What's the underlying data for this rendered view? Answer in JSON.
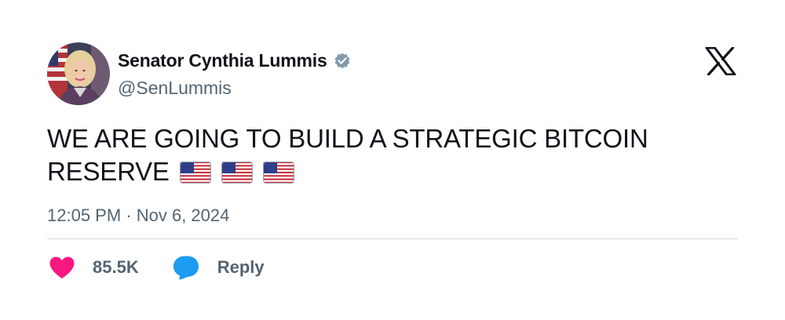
{
  "author": {
    "display_name": "Senator Cynthia Lummis",
    "handle": "@SenLummis",
    "verified": true,
    "verified_badge_color": "#829aab",
    "avatar": "avatar-photo"
  },
  "platform": {
    "logo": "x-logo-icon"
  },
  "tweet": {
    "text": "WE ARE GOING TO BUILD A STRATEGIC BITCOIN RESERVE",
    "emojis": [
      "us-flag-icon",
      "us-flag-icon",
      "us-flag-icon"
    ],
    "timestamp": "12:05 PM · Nov 6, 2024"
  },
  "actions": {
    "like": {
      "icon": "heart-icon",
      "count": "85.5K",
      "color": "#f91880"
    },
    "reply": {
      "icon": "speech-bubble-icon",
      "label": "Reply",
      "color": "#1d9bf0"
    }
  },
  "colors": {
    "text_primary": "#0f1419",
    "text_secondary": "#536471",
    "divider": "#cfd9de",
    "background": "#ffffff"
  }
}
